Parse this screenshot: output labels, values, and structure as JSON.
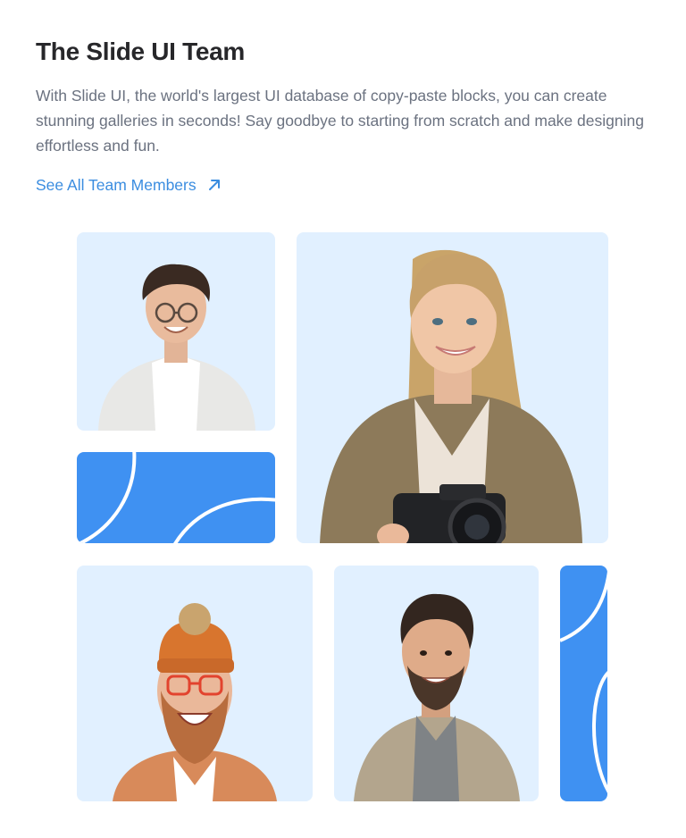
{
  "header": {
    "title": "The Slide UI Team",
    "description": "With Slide UI, the world's largest UI database of copy-paste blocks, you can create stunning galleries in seconds! Say goodbye to starting from scratch and make designing effortless and fun.",
    "link_label": "See All Team Members",
    "link_icon": "arrow-up-right-icon"
  },
  "colors": {
    "accent": "#3b8de0",
    "tile_background": "#e1f0ff",
    "decor_blue": "#3f91f2",
    "title": "#27272a",
    "body_text": "#6b7280"
  },
  "gallery": {
    "photos": [
      "man-with-glasses-white-cardigan",
      "woman-with-camera-olive-jacket",
      "bearded-man-orange-beanie",
      "man-curly-hair-beige-jacket"
    ]
  }
}
